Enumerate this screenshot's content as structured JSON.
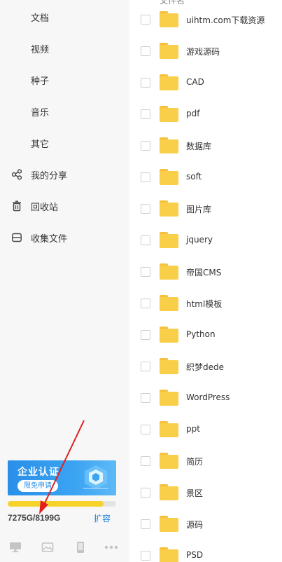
{
  "sidebar": {
    "categories": [
      {
        "label": "文档"
      },
      {
        "label": "视频"
      },
      {
        "label": "种子"
      },
      {
        "label": "音乐"
      },
      {
        "label": "其它"
      }
    ],
    "items": [
      {
        "label": "我的分享",
        "icon": "share-icon"
      },
      {
        "label": "回收站",
        "icon": "trash-icon"
      },
      {
        "label": "收集文件",
        "icon": "collect-icon"
      }
    ]
  },
  "banner": {
    "title": "企业认证",
    "button_label": "限免申请"
  },
  "quota": {
    "text": "7275G/8199G",
    "used_fraction": 0.887,
    "expand_label": "扩容",
    "fill_color": "#f6d32b"
  },
  "bottom_icons": [
    "desktop-icon",
    "image-icon",
    "phone-icon",
    "more-icon"
  ],
  "file_list": {
    "header_label": "文件名",
    "rows": [
      {
        "name": "uihtm.com下载资源"
      },
      {
        "name": "游戏源码"
      },
      {
        "name": "CAD"
      },
      {
        "name": "pdf"
      },
      {
        "name": "数据库"
      },
      {
        "name": "soft"
      },
      {
        "name": "图片库"
      },
      {
        "name": "jquery"
      },
      {
        "name": "帝国CMS"
      },
      {
        "name": "html模板"
      },
      {
        "name": "Python"
      },
      {
        "name": "织梦dede"
      },
      {
        "name": "WordPress"
      },
      {
        "name": "ppt"
      },
      {
        "name": "简历"
      },
      {
        "name": "景区"
      },
      {
        "name": "源码"
      },
      {
        "name": "PSD"
      }
    ]
  },
  "colors": {
    "folder": "#f9cf4a",
    "link": "#1e88e5",
    "annotation_arrow": "#e02020"
  }
}
